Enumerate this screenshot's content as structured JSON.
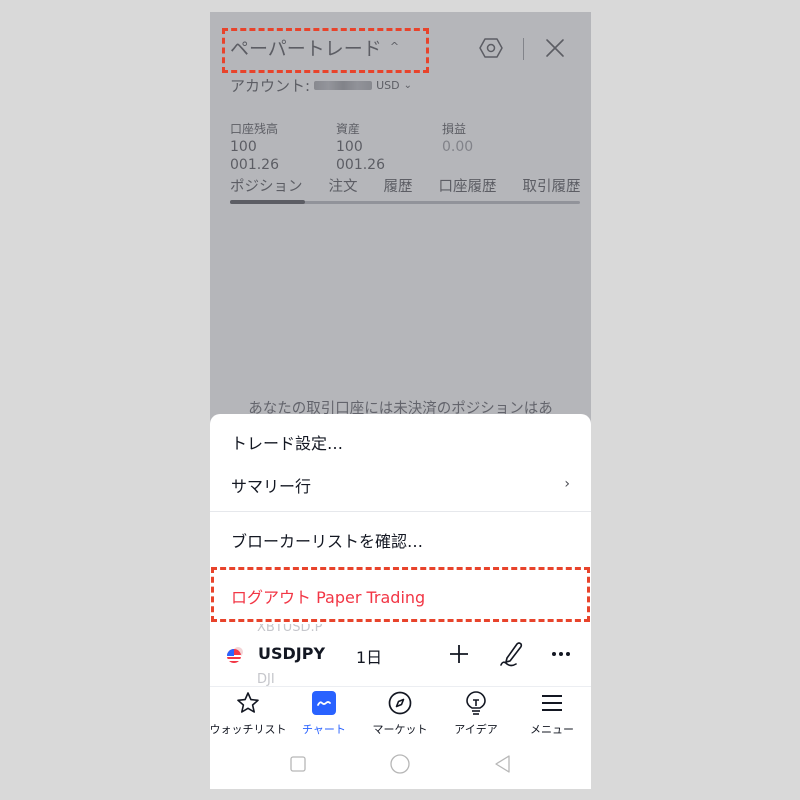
{
  "header": {
    "title": "ペーパートレード",
    "title_caret": "^",
    "settings_icon": "hexagon-gear-icon",
    "close_icon": "close-icon"
  },
  "account": {
    "label": "アカウント:",
    "currency": "USD",
    "chevron": "⌄"
  },
  "stats": [
    {
      "label": "口座残高",
      "value": "100 001.26"
    },
    {
      "label": "資産",
      "value": "100 001.26"
    },
    {
      "label": "損益",
      "value": "0.00"
    }
  ],
  "tabs": [
    {
      "label": "ポジション",
      "active": true
    },
    {
      "label": "注文"
    },
    {
      "label": "履歴"
    },
    {
      "label": "口座履歴"
    },
    {
      "label": "取引履歴"
    }
  ],
  "empty_message": "あなたの取引口座には未決済のポジションはあ",
  "menu": {
    "items": [
      {
        "label": "トレード設定…"
      },
      {
        "label": "サマリー行",
        "chevron": "›"
      },
      {
        "label": "ブローカーリストを確認…"
      },
      {
        "label": "ログアウト Paper Trading",
        "danger": true
      }
    ]
  },
  "chart_bar": {
    "ghost_above": "XBTUSD.P",
    "ghost_below": "DJI",
    "symbol": "USDJPY",
    "interval": "1日",
    "add_icon": "plus-icon",
    "draw_icon": "pen-icon",
    "more_icon": "more-dots-icon"
  },
  "bottom_nav": {
    "accent": "#2962ff",
    "items": [
      {
        "label": "ウォッチリスト",
        "icon": "star-icon"
      },
      {
        "label": "チャート",
        "icon": "chart-icon",
        "active": true
      },
      {
        "label": "マーケット",
        "icon": "compass-icon"
      },
      {
        "label": "アイデア",
        "icon": "lightbulb-icon"
      },
      {
        "label": "メニュー",
        "icon": "menu-icon"
      }
    ]
  },
  "colors": {
    "danger": "#f23645",
    "annotation": "#e8432b"
  }
}
